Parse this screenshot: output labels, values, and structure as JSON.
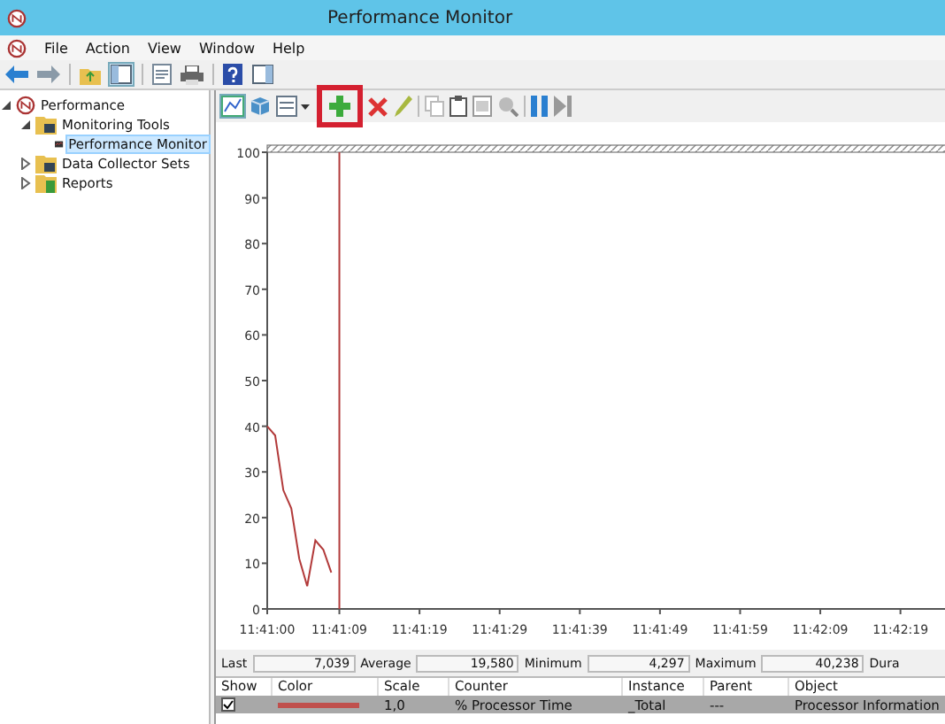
{
  "window": {
    "title": "Performance Monitor"
  },
  "menu": [
    "File",
    "Action",
    "View",
    "Window",
    "Help"
  ],
  "toolbar": [
    {
      "kind": "back"
    },
    {
      "kind": "forward"
    },
    {
      "kind": "sep"
    },
    {
      "kind": "folder"
    },
    {
      "kind": "tree"
    },
    {
      "kind": "sep"
    },
    {
      "kind": "properties"
    },
    {
      "kind": "print"
    },
    {
      "kind": "sep"
    },
    {
      "kind": "help"
    },
    {
      "kind": "pane"
    }
  ],
  "tree": [
    {
      "label": "Performance",
      "kind": "root",
      "expanded": true,
      "selected": false,
      "children": [
        {
          "label": "Monitoring Tools",
          "kind": "folder",
          "expanded": true,
          "selected": false,
          "children": [
            {
              "label": "Performance Monitor",
              "kind": "monitor",
              "selected": true
            }
          ]
        },
        {
          "label": "Data Collector Sets",
          "kind": "folder",
          "expanded": false,
          "selected": false
        },
        {
          "label": "Reports",
          "kind": "report",
          "expanded": false,
          "selected": false
        }
      ]
    }
  ],
  "monitor_toolbar": [
    {
      "kind": "view",
      "highlighted": false
    },
    {
      "kind": "freeze",
      "highlighted": false
    },
    {
      "kind": "graph-type",
      "highlighted": false
    },
    {
      "kind": "add",
      "highlighted": true
    },
    {
      "kind": "delete",
      "highlighted": false
    },
    {
      "kind": "pencil",
      "highlighted": false
    },
    {
      "kind": "sep"
    },
    {
      "kind": "copy",
      "highlighted": false
    },
    {
      "kind": "paste",
      "highlighted": false
    },
    {
      "kind": "properties",
      "highlighted": false
    },
    {
      "kind": "zoom",
      "highlighted": false
    },
    {
      "kind": "sep"
    },
    {
      "kind": "pause",
      "highlighted": false
    },
    {
      "kind": "step",
      "highlighted": false
    }
  ],
  "chart_data": {
    "type": "line",
    "x": [
      42060,
      42061,
      42062,
      42063,
      42064,
      42065,
      42066,
      42067,
      42068
    ],
    "series": [
      {
        "color": "#b23a3a",
        "values": [
          40,
          38,
          26,
          22,
          11,
          5,
          15,
          13,
          8
        ]
      }
    ],
    "xlim": [
      42060,
      42145
    ],
    "ylim": [
      0,
      100
    ],
    "xticks": [
      {
        "value": 42060,
        "label": "11:41:00"
      },
      {
        "value": 42069,
        "label": "11:41:09"
      },
      {
        "value": 42079,
        "label": "11:41:19"
      },
      {
        "value": 42089,
        "label": "11:41:29"
      },
      {
        "value": 42099,
        "label": "11:41:39"
      },
      {
        "value": 42109,
        "label": "11:41:49"
      },
      {
        "value": 42119,
        "label": "11:41:59"
      },
      {
        "value": 42129,
        "label": "11:42:09"
      },
      {
        "value": 42139,
        "label": "11:42:19"
      }
    ],
    "yticks": [
      0,
      10,
      20,
      30,
      40,
      50,
      60,
      70,
      80,
      90,
      100
    ],
    "ref_lines": [
      {
        "axis": "x",
        "value": 42069,
        "color": "#b23a3a"
      }
    ]
  },
  "stats": [
    {
      "label": "Last",
      "value": "7,039"
    },
    {
      "label": "Average",
      "value": "19,580"
    },
    {
      "label": "Minimum",
      "value": "4,297"
    },
    {
      "label": "Maximum",
      "value": "40,238"
    },
    {
      "label": "Dura"
    }
  ],
  "table": {
    "columns": [
      "Show",
      "Color",
      "Scale",
      "Counter",
      "Instance",
      "Parent",
      "Object"
    ],
    "rows": [
      {
        "show": true,
        "color": "#c0504d",
        "scale": "1,0",
        "counter": "% Processor Time",
        "instance": "_Total",
        "parent": "---",
        "object": "Processor Information",
        "selected": true
      }
    ]
  }
}
